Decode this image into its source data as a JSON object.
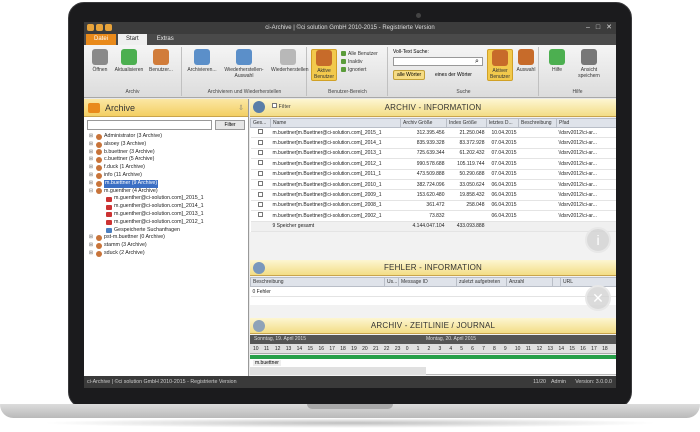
{
  "titlebar": {
    "title": "ci-Archive | ©ci solution GmbH 2010-2015 - Registrierte Version",
    "min": "–",
    "max": "□",
    "close": "✕"
  },
  "tabs": [
    "Datei",
    "Start",
    "Extras"
  ],
  "ribbon": {
    "archiv": {
      "label": "Archiv",
      "buttons": [
        "Öffnen",
        "Aktualisieren",
        "Benutzer..."
      ]
    },
    "archivieren": {
      "label": "Archivieren und Wiederherstellen",
      "buttons": [
        "Archivieren...",
        "Wiederherstellen-Auswahl",
        "Wiederherstellen"
      ]
    },
    "benutzer": {
      "label": "Benutzer-Bereich",
      "active_button": "Aktive Benutzer",
      "options": [
        "Alle Benutzer",
        "Inaktiv",
        "Ignoriert"
      ]
    },
    "suche": {
      "label": "Suche",
      "search_label": "Voll-Text Suche:",
      "chip_all": "alle Wörter",
      "chip_one": "eines der Wörter",
      "btn_active": "Aktiver Benutzer",
      "btn_select": "Auswahl"
    },
    "hilfe": {
      "label": "Hilfe",
      "buttons": [
        "Hilfe",
        "Ansicht speichern"
      ]
    }
  },
  "left": {
    "title": "Archive",
    "filter_button": "Filter",
    "tree": [
      {
        "label": "Administrator (3 Archive)",
        "type": "user",
        "level": 0
      },
      {
        "label": "alsoey (3 Archive)",
        "type": "user",
        "level": 0
      },
      {
        "label": "b.buettner (3 Archive)",
        "type": "user",
        "level": 0
      },
      {
        "label": "c.buettner (5 Archive)",
        "type": "user",
        "level": 0
      },
      {
        "label": "f.duck (1 Archive)",
        "type": "user",
        "level": 0
      },
      {
        "label": "info (11 Archive)",
        "type": "user",
        "level": 0
      },
      {
        "label": "m.buettner (9 Archive)",
        "type": "user",
        "level": 0,
        "selected": true
      },
      {
        "label": "m.guenther (4 Archive)",
        "type": "user",
        "level": 0,
        "expanded": true
      },
      {
        "label": "m.guenther@ci-solution.com]_2015_1",
        "type": "archive",
        "level": 1
      },
      {
        "label": "m.guenther@ci-solution.com]_2014_1",
        "type": "archive",
        "level": 1
      },
      {
        "label": "m.guenther@ci-solution.com]_2013_1",
        "type": "archive",
        "level": 1
      },
      {
        "label": "m.guenther@ci-solution.com]_2012_1",
        "type": "archive",
        "level": 1
      },
      {
        "label": "Gespeicherte Suchanfragen",
        "type": "search",
        "level": 1
      },
      {
        "label": "pst-m.buettner (0 Archive)",
        "type": "user",
        "level": 0
      },
      {
        "label": "stamm (3 Archive)",
        "type": "user",
        "level": 0
      },
      {
        "label": "sduck (2 Archive)",
        "type": "user",
        "level": 0
      }
    ]
  },
  "archiv_info": {
    "title": "ARCHIV - INFORMATION",
    "filter_label": "Filter",
    "columns": [
      "Ges...",
      "Name",
      "Archiv Größe",
      "Index Größe",
      "letztes D...",
      "Beschreibung",
      "Pfad"
    ],
    "rows": [
      [
        "m.buettner[m.Buettner@ci-solution.com]_2015_1",
        "312.395.456",
        "21.250.048",
        "10.04.2015",
        "",
        "\\\\dsrv2012\\ci-ar..."
      ],
      [
        "m.buettner[m.Buettner@ci-solution.com]_2014_1",
        "835.939.328",
        "83.372.928",
        "07.04.2015",
        "",
        "\\\\dsrv2012\\ci-ar..."
      ],
      [
        "m.buettner[m.Buettner@ci-solution.com]_2013_1",
        "725.639.344",
        "61.202.432",
        "07.04.2015",
        "",
        "\\\\dsrv2012\\ci-ar..."
      ],
      [
        "m.buettner[m.Buettner@ci-solution.com]_2012_1",
        "990.578.688",
        "105.119.744",
        "07.04.2015",
        "",
        "\\\\dsrv2012\\ci-ar..."
      ],
      [
        "m.buettner[m.Buettner@ci-solution.com]_2011_1",
        "473.509.888",
        "50.290.688",
        "07.04.2015",
        "",
        "\\\\dsrv2012\\ci-ar..."
      ],
      [
        "m.buettner[m.Buettner@ci-solution.com]_2010_1",
        "382.724.096",
        "33.050.624",
        "06.04.2015",
        "",
        "\\\\dsrv2012\\ci-ar..."
      ],
      [
        "m.buettner[m.Buettner@ci-solution.com]_2009_1",
        "153.620.480",
        "19.858.432",
        "06.04.2015",
        "",
        "\\\\dsrv2012\\ci-ar..."
      ],
      [
        "m.buettner[m.Buettner@ci-solution.com]_2008_1",
        "361.472",
        "258.048",
        "06.04.2015",
        "",
        "\\\\dsrv2012\\ci-ar..."
      ],
      [
        "m.buettner[m.Buettner@ci-solution.com]_2002_1",
        "73.832",
        "",
        "06.04.2015",
        "",
        "\\\\dsrv2012\\ci-ar..."
      ]
    ],
    "total": {
      "label": "9 Speicher gesamt",
      "archive": "4.144.047.104",
      "index": "433.093.888"
    }
  },
  "fehler_info": {
    "title": "FEHLER - INFORMATION",
    "columns": [
      "Beschreibung",
      "Us...",
      "Message ID",
      "zuletzt aufgetreten",
      "Anzahl",
      "",
      "URL"
    ],
    "summary": "0 Fehler"
  },
  "journal": {
    "title": "ARCHIV - ZEITLINIE / JOURNAL",
    "day1": "Sonntag, 19. April 2015",
    "day2": "Montag, 20. April 2015",
    "hours": [
      "10",
      "11",
      "12",
      "13",
      "14",
      "15",
      "16",
      "17",
      "18",
      "19",
      "20",
      "21",
      "22",
      "23",
      "0",
      "1",
      "2",
      "3",
      "4",
      "5",
      "6",
      "7",
      "8",
      "9",
      "10",
      "11",
      "12",
      "13",
      "14",
      "15",
      "16",
      "17",
      "18"
    ],
    "row_user": "m.buettner"
  },
  "status": {
    "left": "ci-Archive | ©ci solution GmbH 2010-2015 - Registrierte Version",
    "count": "11/20",
    "user": "Admin",
    "version": "Version: 3.0.0.0"
  }
}
